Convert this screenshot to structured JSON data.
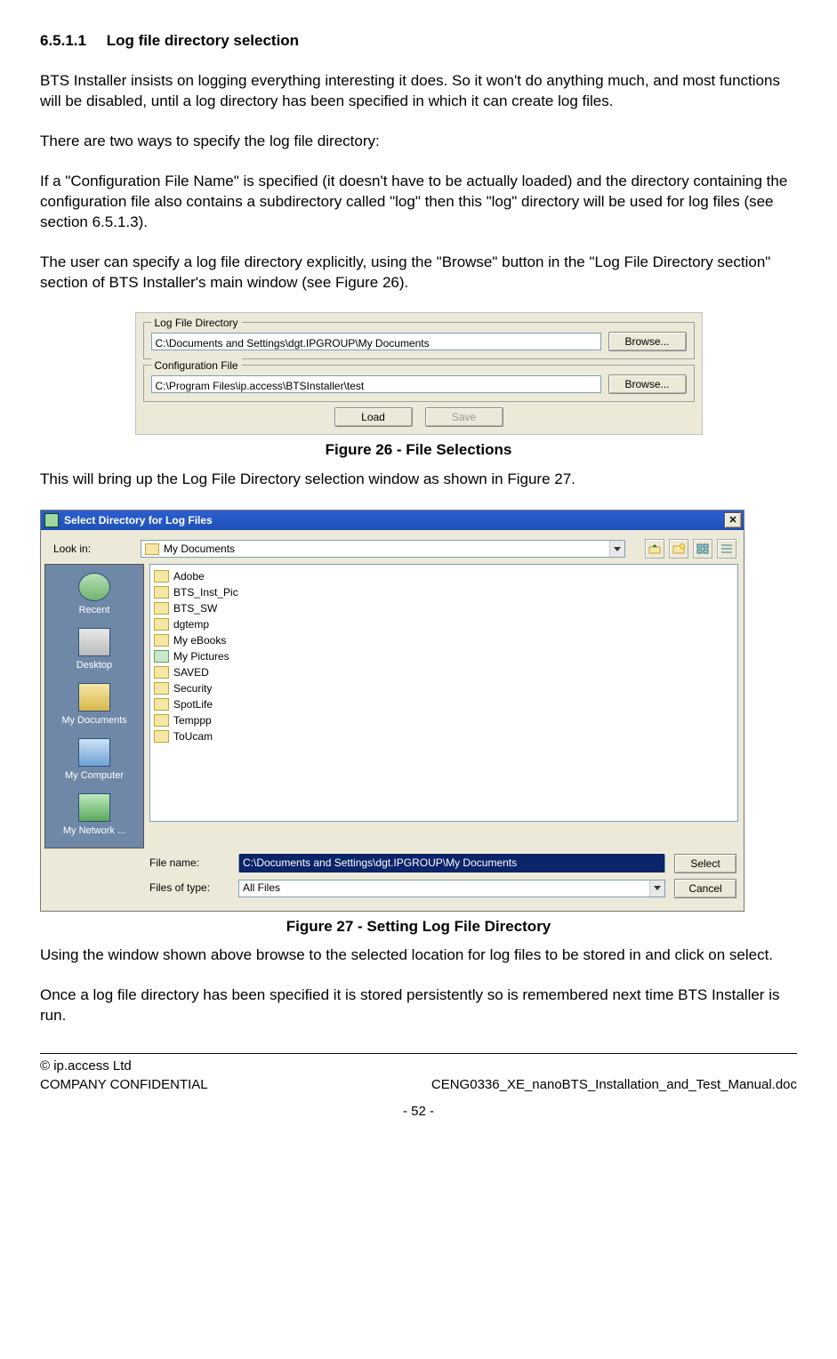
{
  "heading": {
    "number": "6.5.1.1",
    "title": "Log file directory selection"
  },
  "para1": "BTS Installer insists on logging everything interesting it does. So it won't do anything much, and most functions will be disabled, until a log directory has been specified in which it can create log files.",
  "para2": "There are two ways to specify the log file directory:",
  "para3": "If a \"Configuration File Name\" is specified (it doesn't have to be actually loaded) and the directory containing the configuration file also contains a subdirectory called \"log\" then this \"log\" directory will be used for log files (see section 6.5.1.3).",
  "para4": "The user can specify a log file directory explicitly, using the \"Browse\" button in the \"Log File Directory section\" section of BTS Installer's main window (see Figure 26).",
  "fig26": {
    "logdir": {
      "legend": "Log File Directory",
      "value": "C:\\Documents and Settings\\dgt.IPGROUP\\My Documents",
      "browse": "Browse..."
    },
    "config": {
      "legend": "Configuration File",
      "value": "C:\\Program Files\\ip.access\\BTSInstaller\\test",
      "browse": "Browse..."
    },
    "load": "Load",
    "save": "Save",
    "caption": "Figure 26 - File Selections"
  },
  "para5": "This will bring up the Log File Directory selection window as shown in Figure 27.",
  "fig27": {
    "title": "Select Directory for Log Files",
    "lookin_label": "Look in:",
    "lookin_value": "My Documents",
    "places": {
      "recent": "Recent",
      "desktop": "Desktop",
      "mydocs": "My Documents",
      "mycomp": "My Computer",
      "mynet": "My Network ..."
    },
    "files": [
      "Adobe",
      "BTS_Inst_Pic",
      "BTS_SW",
      "dgtemp",
      "My eBooks",
      "My Pictures",
      "SAVED",
      "Security",
      "SpotLife",
      "Temppp",
      "ToUcam"
    ],
    "filename_label": "File name:",
    "filename_value": "C:\\Documents and Settings\\dgt.IPGROUP\\My Documents",
    "filetype_label": "Files of type:",
    "filetype_value": "All Files",
    "select": "Select",
    "cancel": "Cancel",
    "caption": "Figure 27 - Setting Log File Directory"
  },
  "para6": "Using the window shown above browse to the selected location for log files to be stored in and click on select.",
  "para7": "Once a log file directory has been specified it is stored persistently so is remembered next time BTS Installer is run.",
  "footer": {
    "copyright": "© ip.access Ltd",
    "left": "COMPANY CONFIDENTIAL",
    "right": "CENG0336_XE_nanoBTS_Installation_and_Test_Manual.doc",
    "page": "- 52 -"
  }
}
